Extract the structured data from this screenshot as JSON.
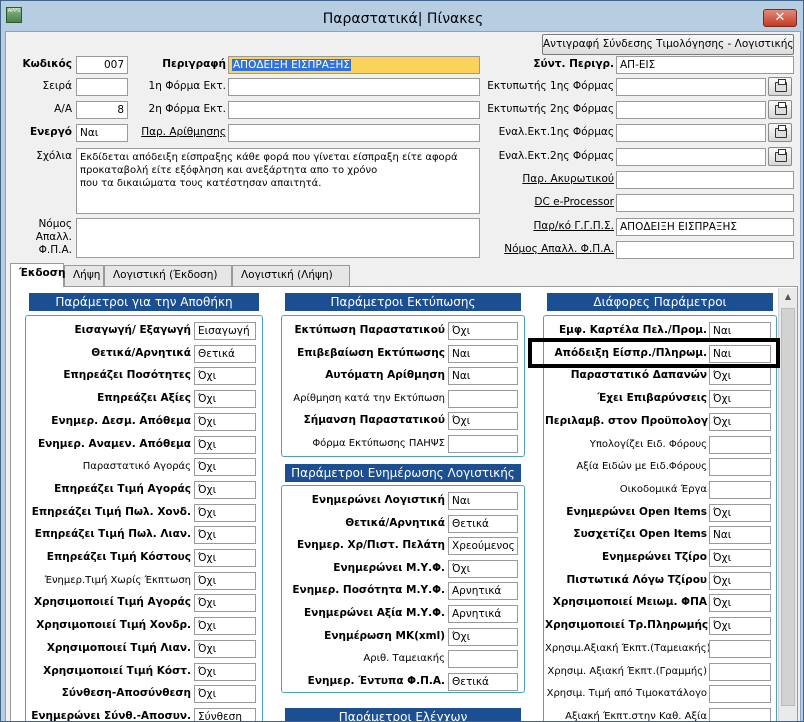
{
  "window": {
    "title": "Παραστατικά| Πίνακες",
    "icon_label": "APPS"
  },
  "toolbar": {
    "copy_button": "Αντιγραφή Σύνδεσης Τιμολόγησης - Λογιστικής"
  },
  "header": {
    "code_label": "Κωδικός",
    "code_value": "007",
    "description_label": "Περιγραφή",
    "description_value": "ΑΠΟΔΕΙΞΗ ΕΙΣΠΡΑΞΗΣ",
    "abbr_label": "Σύντ. Περιγρ.",
    "abbr_value": "ΑΠ-ΕΙΣ",
    "series_label": "Σειρά",
    "series_value": "",
    "form1_label": "1η Φόρμα Εκτ.",
    "form1_value": "",
    "printer1_label": "Εκτυπωτής 1ης Φόρμας",
    "printer1_value": "",
    "aa_label": "Α/Α",
    "aa_value": "8",
    "form2_label": "2η Φόρμα Εκτ.",
    "form2_value": "",
    "printer2_label": "Εκτυπωτής 2ης Φόρμας",
    "printer2_value": "",
    "active_label": "Ενεργό",
    "active_value": "Ναι",
    "numbering_label": "Παρ. Αρίθμησης",
    "numbering_value": "",
    "alt1_label": "Εναλ.Εκτ.1ης Φόρμας",
    "alt1_value": "",
    "alt2_label": "Εναλ.Εκτ.2ης Φόρμας",
    "alt2_value": "",
    "comments_label": "Σχόλια",
    "comments_value": "Εκδίδεται απόδειξη είσπραξης κάθε φορά  που γίνεται είσπραξη είτε αφορά\nπροκαταβολή είτε εξόφληση  και ανεξάρτητα απο το χρόνο\nπου τα δικαιώματα τους κατέστησαν απαιτητά.",
    "cancel_label": "Παρ. Ακυρωτικού",
    "cancel_value": "",
    "dc_label": "DC e-Processor",
    "dc_value": "",
    "ggps_label": "Παρ/κό Γ.Γ.Π.Σ.",
    "ggps_value": "ΑΠΟΔΕΙΞΗ ΕΙΣΠΡΑΞΗΣ",
    "vat_exempt_label": "Νόμος Απαλλ. Φ.Π.Α.",
    "vat_exempt_value": "",
    "law_label": "Νόμος\nΑπαλλ.\nΦ.Π.Α.",
    "law_value": ""
  },
  "tabs": [
    "Έκδοση",
    "Λήψη",
    "Λογιστική (Έκδοση)",
    "Λογιστική (Λήψη)"
  ],
  "warehouse": {
    "title": "Παράμετροι για την Αποθήκη",
    "rows": [
      {
        "label": "Εισαγωγή/ Εξαγωγή",
        "value": "Εισαγωγή",
        "bold": true
      },
      {
        "label": "Θετικά/Αρνητικά",
        "value": "Θετικά",
        "bold": true
      },
      {
        "label": "Επηρεάζει Ποσότητες",
        "value": "Όχι",
        "bold": true
      },
      {
        "label": "Επηρεάζει Αξίες",
        "value": "Όχι",
        "bold": true
      },
      {
        "label": "Ενημερ. Δεσμ. Απόθεμα",
        "value": "Όχι",
        "bold": true
      },
      {
        "label": "Ενημερ. Αναμεν. Απόθεμα",
        "value": "Όχι",
        "bold": true
      },
      {
        "label": "Παραστατικό Αγοράς",
        "value": "Όχι",
        "bold": false
      },
      {
        "label": "Επηρεάζει Τιμή Αγοράς",
        "value": "Όχι",
        "bold": true
      },
      {
        "label": "Επηρεάζει Τιμή Πωλ. Χονδ.",
        "value": "Όχι",
        "bold": true
      },
      {
        "label": "Επηρεάζει Τιμή Πωλ. Λιαν.",
        "value": "Όχι",
        "bold": true
      },
      {
        "label": "Επηρεάζει Τιμή Κόστους",
        "value": "Όχι",
        "bold": true
      },
      {
        "label": "Ένημερ.Τιμή Χωρίς Έκπτωση",
        "value": "Όχι",
        "bold": false
      },
      {
        "label": "Χρησιμοποιεί Τιμή Αγοράς",
        "value": "Όχι",
        "bold": true
      },
      {
        "label": "Χρησιμοποιεί Τιμή Χονδρ.",
        "value": "Όχι",
        "bold": true
      },
      {
        "label": "Χρησιμοποιεί Τιμή Λιαν.",
        "value": "Όχι",
        "bold": true
      },
      {
        "label": "Χρησιμοποιεί Τιμή Κόστ.",
        "value": "Όχι",
        "bold": true
      },
      {
        "label": "Σύνθεση-Αποσύνθεση",
        "value": "Όχι",
        "bold": true
      },
      {
        "label": "Ενημερώνει Σύνθ.-Αποσυν.",
        "value": "Σύνθεση",
        "bold": true
      }
    ]
  },
  "printing": {
    "title": "Παράμετροι Εκτύπωσης",
    "rows": [
      {
        "label": "Εκτύπωση Παραστατικού",
        "value": "Όχι",
        "bold": true
      },
      {
        "label": "Επιβεβαίωση Εκτύπωσης",
        "value": "Ναι",
        "bold": true
      },
      {
        "label": "Αυτόματη Αρίθμηση",
        "value": "Ναι",
        "bold": true
      },
      {
        "label": "Αρίθμηση κατά την Εκτύπωση",
        "value": "",
        "bold": false
      },
      {
        "label": "Σήμανση Παραστατικού",
        "value": "Όχι",
        "bold": true
      },
      {
        "label": "Φόρμα Εκτύπωσης ΠΑΗΨΣ",
        "value": "",
        "bold": false
      }
    ]
  },
  "accounting": {
    "title": "Παράμετροι Ενημέρωσης Λογιστικής",
    "rows": [
      {
        "label": "Ενημερώνει Λογιστική",
        "value": "Ναι",
        "bold": true
      },
      {
        "label": "Θετικά/Αρνητικά",
        "value": "Θετικά",
        "bold": true
      },
      {
        "label": "Ενημερ. Χρ/Πιστ. Πελάτη",
        "value": "Χρεούμενος",
        "bold": true
      },
      {
        "label": "Ενημερώνει Μ.Υ.Φ.",
        "value": "Όχι",
        "bold": true
      },
      {
        "label": "Ενημερ. Ποσότητα Μ.Υ.Φ.",
        "value": "Αρνητικά",
        "bold": true
      },
      {
        "label": "Ενημερώνει  Αξία Μ.Υ.Φ.",
        "value": "Αρνητικά",
        "bold": true
      },
      {
        "label": "Ενημέρωση ΜΚ(xml)",
        "value": "Όχι",
        "bold": true
      },
      {
        "label": "Αριθ. Ταμειακής",
        "value": "",
        "bold": false
      },
      {
        "label": "Ενημερ. Έντυπα Φ.Π.Α.",
        "value": "Θετικά",
        "bold": true
      }
    ]
  },
  "checks": {
    "title": "Παράμετροι Ελέγχων"
  },
  "misc": {
    "title": "Διάφορες Παράμετροι",
    "rows": [
      {
        "label": "Εμφ. Καρτέλα Πελ./Προμ.",
        "value": "Ναι",
        "bold": true
      },
      {
        "label": "Απόδειξη Είσπρ./Πληρωμ.",
        "value": "Ναι",
        "bold": true
      },
      {
        "label": "Παραστατικό Δαπανών",
        "value": "Όχι",
        "bold": true
      },
      {
        "label": "Έχει Επιβαρύνσεις",
        "value": "Όχι",
        "bold": true
      },
      {
        "label": "Περιλαμβ. στον Προϋπολογ.",
        "value": "Όχι",
        "bold": true
      },
      {
        "label": "Υπολογίζει Ειδ. Φόρους",
        "value": "",
        "bold": false
      },
      {
        "label": "Αξία Ειδών με Ειδ.Φόρους",
        "value": "",
        "bold": false
      },
      {
        "label": "Οικοδομικά Έργα",
        "value": "",
        "bold": false
      },
      {
        "label": "Ενημερώνει Open Items",
        "value": "Όχι",
        "bold": true
      },
      {
        "label": "Συσχετίζει Open Items",
        "value": "Ναι",
        "bold": true
      },
      {
        "label": "Ενημερώνει Τζίρο",
        "value": "Όχι",
        "bold": true
      },
      {
        "label": "Πιστωτικά Λόγω Τζίρου",
        "value": "Όχι",
        "bold": true
      },
      {
        "label": "Χρησιμοποιεί Μειωμ. ΦΠΑ",
        "value": "Όχι",
        "bold": true
      },
      {
        "label": "Χρησιμοποιεί Τρ.Πληρωμής",
        "value": "Όχι",
        "bold": true
      },
      {
        "label": "Χρησιμ.Αξιακή Έκπτ.(Ταμειακής)",
        "value": "",
        "bold": false
      },
      {
        "label": "Χρησιμ. Αξιακή Έκπτ.(Γραμμής)",
        "value": "",
        "bold": false
      },
      {
        "label": "Χρησιμ. Τιμή από Τιμοκατάλογο",
        "value": "",
        "bold": false
      },
      {
        "label": "Αξιακή  Έκπτ.στην Καθ. Αξία",
        "value": "",
        "bold": false
      }
    ]
  }
}
